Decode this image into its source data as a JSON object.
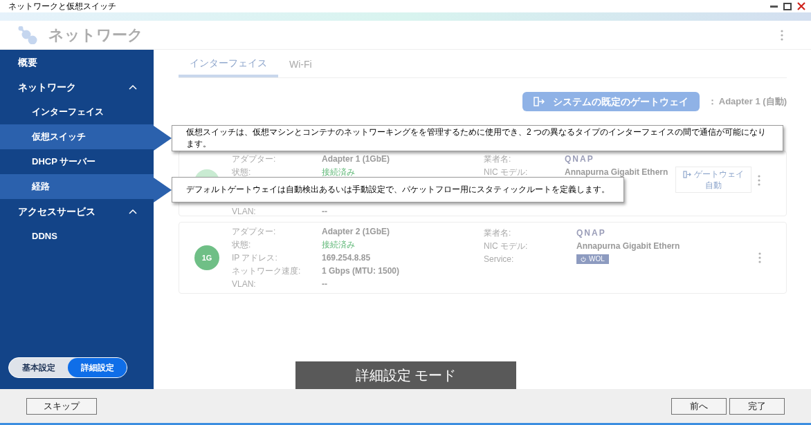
{
  "window": {
    "title": "ネットワークと仮想スイッチ"
  },
  "header": {
    "title": "ネットワーク"
  },
  "sidebar": {
    "items": [
      {
        "label": "概要",
        "kind": "section",
        "selected": false
      },
      {
        "label": "ネットワーク",
        "kind": "section",
        "expanded": true,
        "selected": false
      },
      {
        "label": "インターフェイス",
        "kind": "item",
        "selected": false
      },
      {
        "label": "仮想スイッチ",
        "kind": "item",
        "selected": true
      },
      {
        "label": "DHCP サーバー",
        "kind": "item",
        "selected": false
      },
      {
        "label": "経路",
        "kind": "item",
        "selected": true
      },
      {
        "label": "アクセスサービス",
        "kind": "section",
        "expanded": true,
        "selected": false
      },
      {
        "label": "DDNS",
        "kind": "item",
        "selected": false
      }
    ]
  },
  "mode_toggle": [
    {
      "label": "基本設定",
      "selected": false
    },
    {
      "label": "詳細設定",
      "selected": true
    }
  ],
  "tabs": [
    {
      "label": "インターフェイス",
      "selected": true
    },
    {
      "label": "Wi-Fi",
      "selected": false
    }
  ],
  "gateway": {
    "button": "システムの既定のゲートウェイ",
    "value": "：  Adapter 1 (自動)"
  },
  "adapters": [
    {
      "left": [
        {
          "label": "アダプター:",
          "value": "Adapter 1 (1GbE)",
          "kind": "text"
        },
        {
          "label": "状態:",
          "value": "接続済み",
          "kind": "status"
        },
        {
          "label": "VLAN:",
          "value": "--",
          "kind": "text"
        }
      ],
      "right": [
        {
          "label": "業者名:",
          "value": "QNAP",
          "kind": "logo"
        },
        {
          "label": "NIC モデル:",
          "value": "Annapurna Gigabit Ethern",
          "kind": "text"
        }
      ],
      "gateway_button": {
        "label": "ゲートウェイ",
        "value": "自動"
      }
    },
    {
      "badge": "1G",
      "left": [
        {
          "label": "アダプター:",
          "value": "Adapter 2 (1GbE)",
          "kind": "text"
        },
        {
          "label": "状態:",
          "value": "接続済み",
          "kind": "status"
        },
        {
          "label": "IP アドレス:",
          "value": "169.254.8.85",
          "kind": "text"
        },
        {
          "label": "ネットワーク速度:",
          "value": "1 Gbps (MTU: 1500)",
          "kind": "text"
        },
        {
          "label": "VLAN:",
          "value": "--",
          "kind": "text"
        }
      ],
      "right": [
        {
          "label": "業者名:",
          "value": "QNAP",
          "kind": "logo"
        },
        {
          "label": "NIC モデル:",
          "value": "Annapurna Gigabit Ethern",
          "kind": "text"
        },
        {
          "label": "Service:",
          "value": "WOL",
          "kind": "badge"
        }
      ]
    }
  ],
  "tooltips": [
    {
      "text": "仮想スイッチは、仮想マシンとコンテナのネットワーキングをを管理するために使用でき、2 つの異なるタイプのインターフェイスの間で通信が可能になります。"
    },
    {
      "text": "デフォルトゲートウェイは自動検出あるいは手動設定で、パケットフロー用にスタティックルートを定義します。"
    }
  ],
  "mode_banner": "詳細設定 モード",
  "footer": {
    "skip": "スキップ",
    "back": "前へ",
    "finish": "完了"
  }
}
